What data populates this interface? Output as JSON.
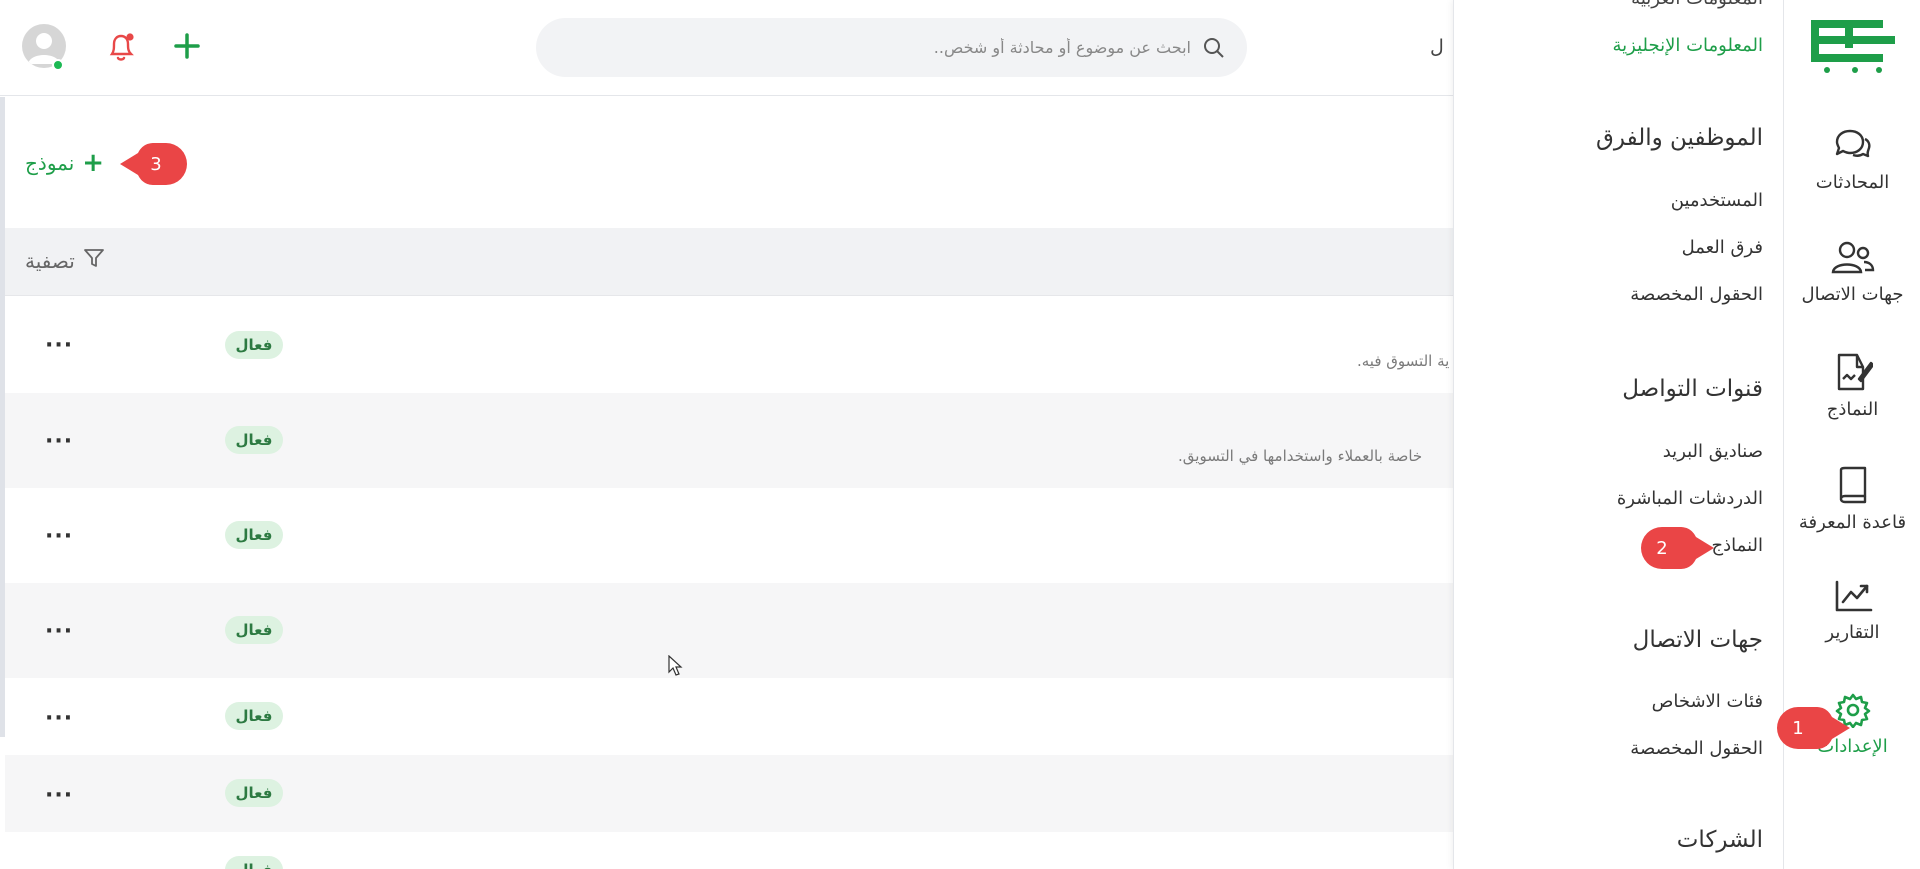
{
  "colors": {
    "brand_green": "#1e9e49",
    "callout_red": "#ea4546",
    "badge_bg": "#ddf2e1"
  },
  "header": {
    "search_placeholder": "ابحث عن موضوع أو محادثة أو شخص..",
    "cut_label": "ل",
    "icons": [
      "avatar",
      "bell-icon",
      "plus-icon",
      "search-icon"
    ]
  },
  "content": {
    "add_form_label": "نموذج",
    "filter_label": "تصفية",
    "rows": [
      {
        "status": "فعال",
        "description": "ية التسوق فيه."
      },
      {
        "status": "فعال",
        "description": "خاصة بالعملاء واستخدامها في التسويق."
      },
      {
        "status": "فعال",
        "description": ""
      },
      {
        "status": "فعال",
        "description": ""
      },
      {
        "status": "فعال",
        "description": ""
      },
      {
        "status": "فعال",
        "description": ""
      },
      {
        "status": "فعال",
        "description": ""
      }
    ]
  },
  "settings_panel": {
    "top_item_cut": "المعلومات العربية",
    "english_info": "المعلومات الإنجليزية",
    "section_staff": "الموظفين والفرق",
    "users": "المستخدمين",
    "teams": "فرق العمل",
    "custom_fields_1": "الحقول المخصصة",
    "section_channels": "قنوات التواصل",
    "mailboxes": "صناديق البريد",
    "live_chats": "الدردشات المباشرة",
    "forms": "النماذج",
    "section_contacts": "جهات الاتصال",
    "people_categories": "فئات الاشخاص",
    "custom_fields_2": "الحقول المخصصة",
    "section_companies": "الشركات"
  },
  "rail": {
    "items": [
      {
        "label": "المحادثات",
        "icon": "chat-icon"
      },
      {
        "label": "جهات الاتصال",
        "icon": "contacts-icon"
      },
      {
        "label": "النماذج",
        "icon": "forms-icon"
      },
      {
        "label": "قاعدة المعرفة",
        "icon": "book-icon"
      },
      {
        "label": "التقارير",
        "icon": "reports-icon"
      },
      {
        "label": "الإعدادات",
        "icon": "gear-icon"
      }
    ]
  },
  "callouts": {
    "one": "1",
    "two": "2",
    "three": "3"
  }
}
